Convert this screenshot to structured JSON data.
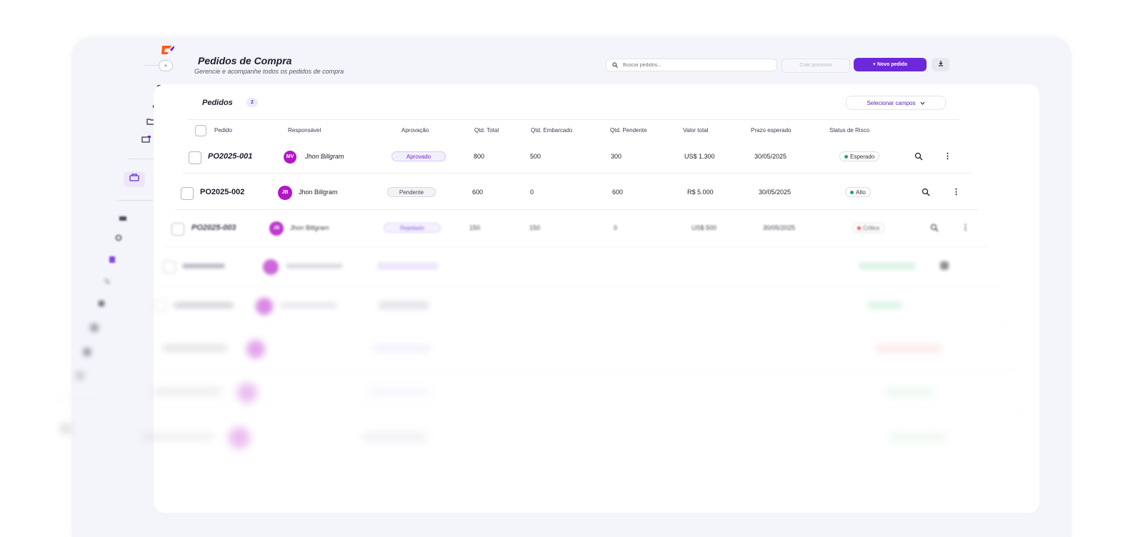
{
  "app": {
    "brand_color": "#6d28d9",
    "logo_color": "#ff5a1f"
  },
  "header": {
    "title": "Pedidos de Compra",
    "subtitle": "Gerencie e acompanhe todos os pedidos de compra",
    "search_placeholder": "Buscar pedidos...",
    "create_process_label": "Criar processo",
    "new_order_label": "+ Novo pedido",
    "export_icon": "download-icon"
  },
  "card": {
    "title": "Pedidos",
    "count": "2",
    "select_fields_label": "Selecionar campos"
  },
  "table": {
    "columns": {
      "pedido": "Pedido",
      "responsavel": "Responsável",
      "aprovacao": "Aprovação",
      "qtd_total": "Qtd. Total",
      "qtd_embarcado": "Qtd. Embarcado",
      "qtd_pendente": "Qtd. Pendente",
      "valor_total": "Valor total",
      "prazo": "Prazo esperado",
      "risco": "Status de Risco"
    },
    "rows": [
      {
        "id": "PO2025-001",
        "initials": "MV",
        "responsavel": "Jhon Billgram",
        "aprovacao": "Aprovado",
        "qtd_total": "800",
        "qtd_embarcado": "500",
        "qtd_pendente": "300",
        "valor_total": "US$ 1.300",
        "prazo": "30/05/2025",
        "risco": "Esperado",
        "risco_color": "#22a55a"
      },
      {
        "id": "PO2025-002",
        "initials": "JB",
        "responsavel": "Jhon Billgram",
        "aprovacao": "Pendente",
        "qtd_total": "600",
        "qtd_embarcado": "0",
        "qtd_pendente": "600",
        "valor_total": "R$ 5.000",
        "prazo": "30/05/2025",
        "risco": "Alto",
        "risco_color": "#22a55a"
      },
      {
        "id": "PO2025-003",
        "initials": "JB",
        "responsavel": "Jhon Billgram",
        "aprovacao": "Rejeitado",
        "qtd_total": "150",
        "qtd_embarcado": "150",
        "qtd_pendente": "0",
        "valor_total": "US$ 500",
        "prazo": "30/05/2025",
        "risco": "Crítico",
        "risco_color": "#e02424"
      }
    ]
  }
}
